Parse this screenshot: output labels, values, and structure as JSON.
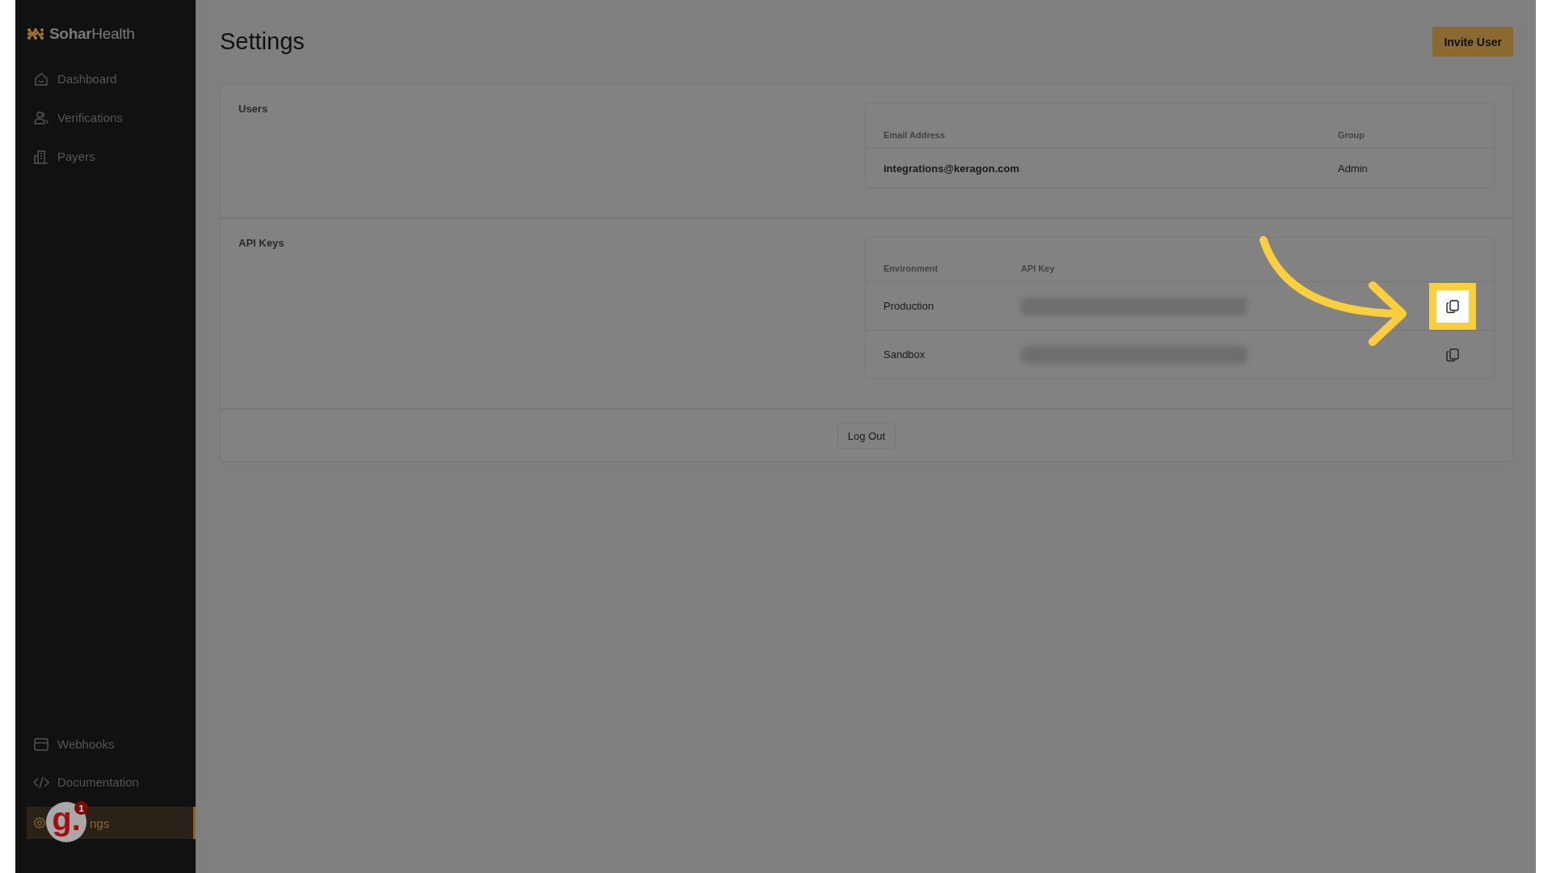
{
  "sidebar": {
    "logo": {
      "bold": "Sohar",
      "light": "Health"
    },
    "nav_top": [
      {
        "label": "Dashboard",
        "selected": false
      },
      {
        "label": "Verifications",
        "selected": false
      },
      {
        "label": "Payers",
        "selected": false
      }
    ],
    "nav_bottom": [
      {
        "label": "Webhooks",
        "selected": false
      },
      {
        "label": "Documentation",
        "selected": false
      },
      {
        "label": "ngs",
        "selected": true
      }
    ]
  },
  "help_widget": {
    "glyph": "g.",
    "badge": "1"
  },
  "page": {
    "title": "Settings",
    "invite_button": "Invite User"
  },
  "users": {
    "heading": "Users",
    "columns": [
      "Email Address",
      "Group"
    ],
    "rows": [
      {
        "email": "integrations@keragon.com",
        "group": "Admin"
      }
    ]
  },
  "api_keys": {
    "heading": "API Keys",
    "columns": [
      "Environment",
      "API Key"
    ],
    "rows": [
      {
        "environment": "Production",
        "highlighted": true
      },
      {
        "environment": "Sandbox",
        "highlighted": false
      }
    ]
  },
  "logout_button": "Log Out"
}
